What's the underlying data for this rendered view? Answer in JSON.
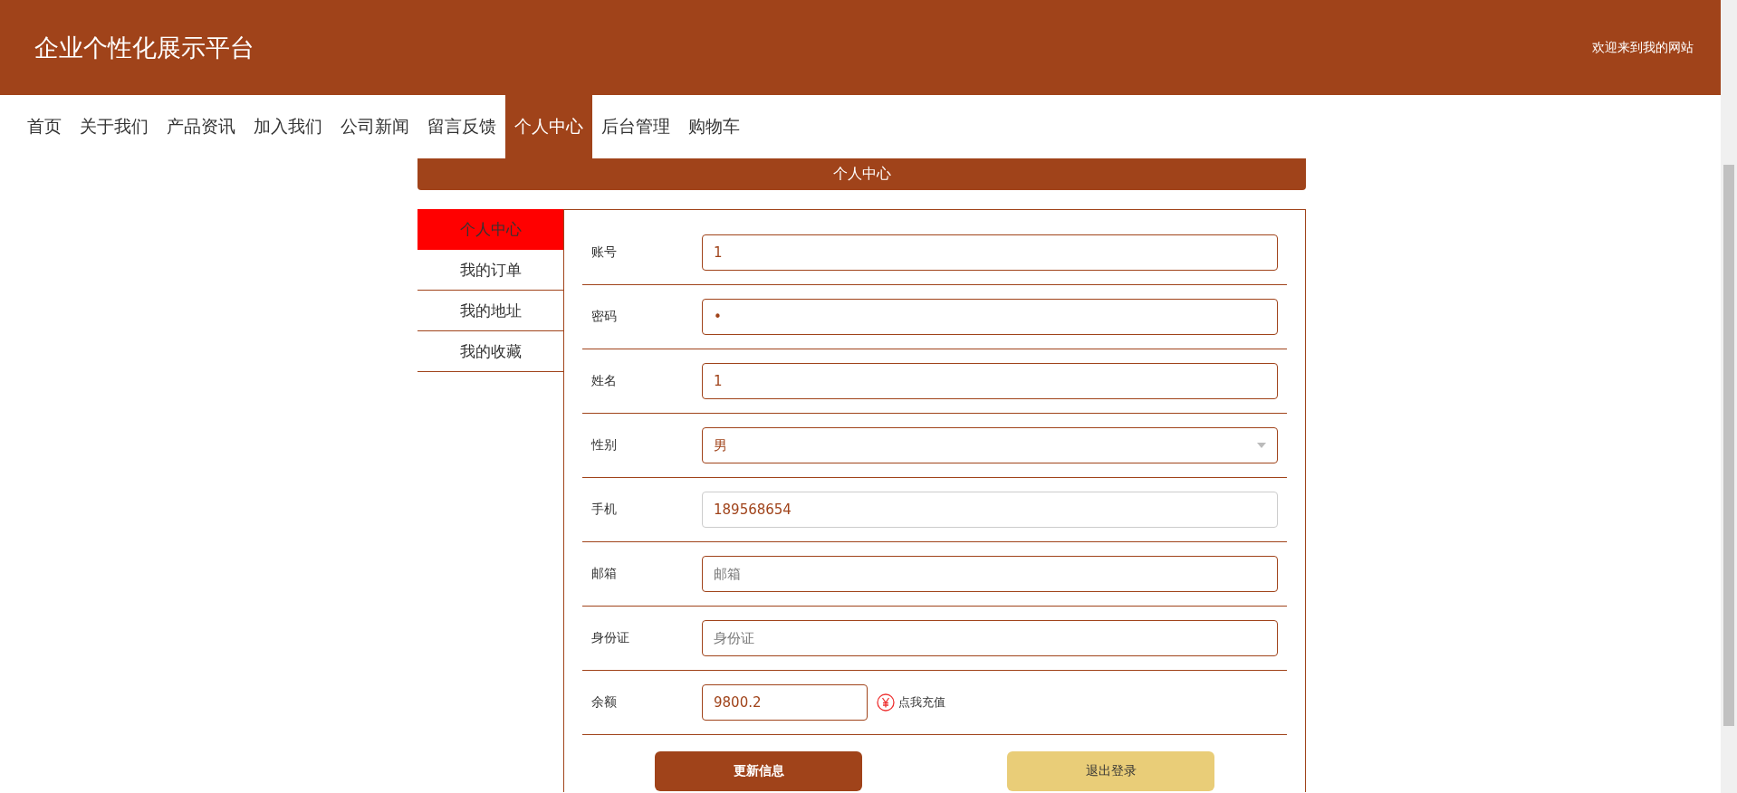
{
  "header": {
    "title": "企业个性化展示平台",
    "welcome": "欢迎来到我的网站"
  },
  "nav": [
    {
      "label": "首页",
      "selected": false
    },
    {
      "label": "关于我们",
      "selected": false
    },
    {
      "label": "产品资讯",
      "selected": false
    },
    {
      "label": "加入我们",
      "selected": false
    },
    {
      "label": "公司新闻",
      "selected": false
    },
    {
      "label": "留言反馈",
      "selected": false
    },
    {
      "label": "个人中心",
      "selected": true
    },
    {
      "label": "后台管理",
      "selected": false
    },
    {
      "label": "购物车",
      "selected": false
    }
  ],
  "page_title": "个人中心",
  "sidebar": [
    {
      "label": "个人中心",
      "selected": true
    },
    {
      "label": "我的订单",
      "selected": false
    },
    {
      "label": "我的地址",
      "selected": false
    },
    {
      "label": "我的收藏",
      "selected": false
    }
  ],
  "form": [
    {
      "kind": "input",
      "label": "账号",
      "value": "1",
      "focused": false
    },
    {
      "kind": "input",
      "label": "密码",
      "value": "•",
      "focused": false
    },
    {
      "kind": "input",
      "label": "姓名",
      "value": "1",
      "focused": false
    },
    {
      "kind": "select",
      "label": "性别",
      "value": "男",
      "focused": false
    },
    {
      "kind": "input",
      "label": "手机",
      "value": "189568654",
      "focused": true
    },
    {
      "kind": "input",
      "label": "邮箱",
      "placeholder": "邮箱",
      "focused": false
    },
    {
      "kind": "input",
      "label": "身份证",
      "placeholder": "身份证",
      "focused": false
    },
    {
      "kind": "balance",
      "label": "余额",
      "value": "9800.2",
      "link": "点我充值",
      "focused": false
    }
  ],
  "buttons": [
    {
      "kind": "primary",
      "label": "更新信息"
    },
    {
      "kind": "secondary",
      "label": "退出登录"
    }
  ]
}
